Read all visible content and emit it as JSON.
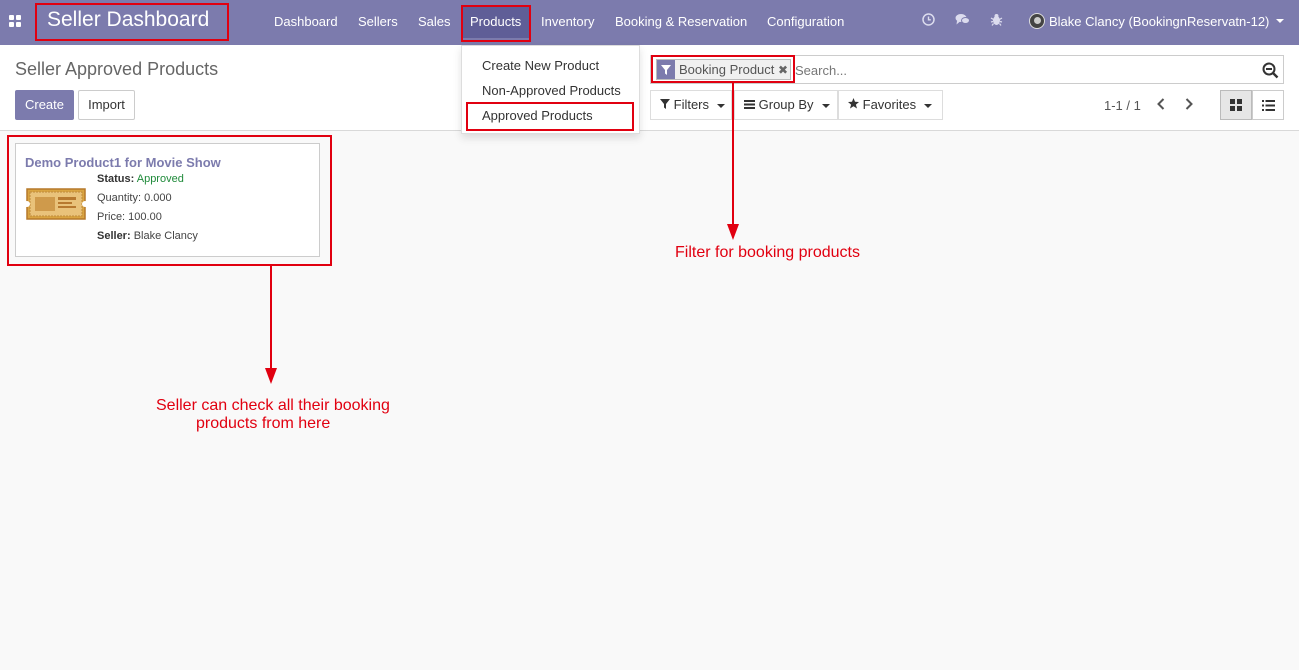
{
  "navbar": {
    "brand": "Seller Dashboard",
    "menu": [
      "Dashboard",
      "Sellers",
      "Sales",
      "Products",
      "Inventory",
      "Booking & Reservation",
      "Configuration"
    ],
    "user": "Blake Clancy (BookingnReservatn-12)",
    "icons": [
      "apps-icon",
      "clock-icon",
      "chat-icon",
      "bug-icon"
    ]
  },
  "control_panel": {
    "title": "Seller Approved Products",
    "create_label": "Create",
    "import_label": "Import",
    "search": {
      "facet": "Booking Product",
      "placeholder": "Search..."
    },
    "filters_label": "Filters",
    "groupby_label": "Group By",
    "favorites_label": "Favorites",
    "pager": "1-1 / 1"
  },
  "products_menu": [
    "Create New Product",
    "Non-Approved Products",
    "Approved Products"
  ],
  "card": {
    "title": "Demo Product1 for Movie Show",
    "status_label": "Status:",
    "status_value": "Approved",
    "quantity": "Quantity: 0.000",
    "price": "Price: 100.00",
    "seller_label": "Seller:",
    "seller_value": "Blake Clancy"
  },
  "annotations": {
    "filter_note": "Filter for booking products",
    "seller_note_line1": "Seller can check all their booking",
    "seller_note_line2": "products from here"
  },
  "colors": {
    "primary": "#7c7bad",
    "annotation": "#e10010",
    "approved": "#1f8a3a"
  }
}
